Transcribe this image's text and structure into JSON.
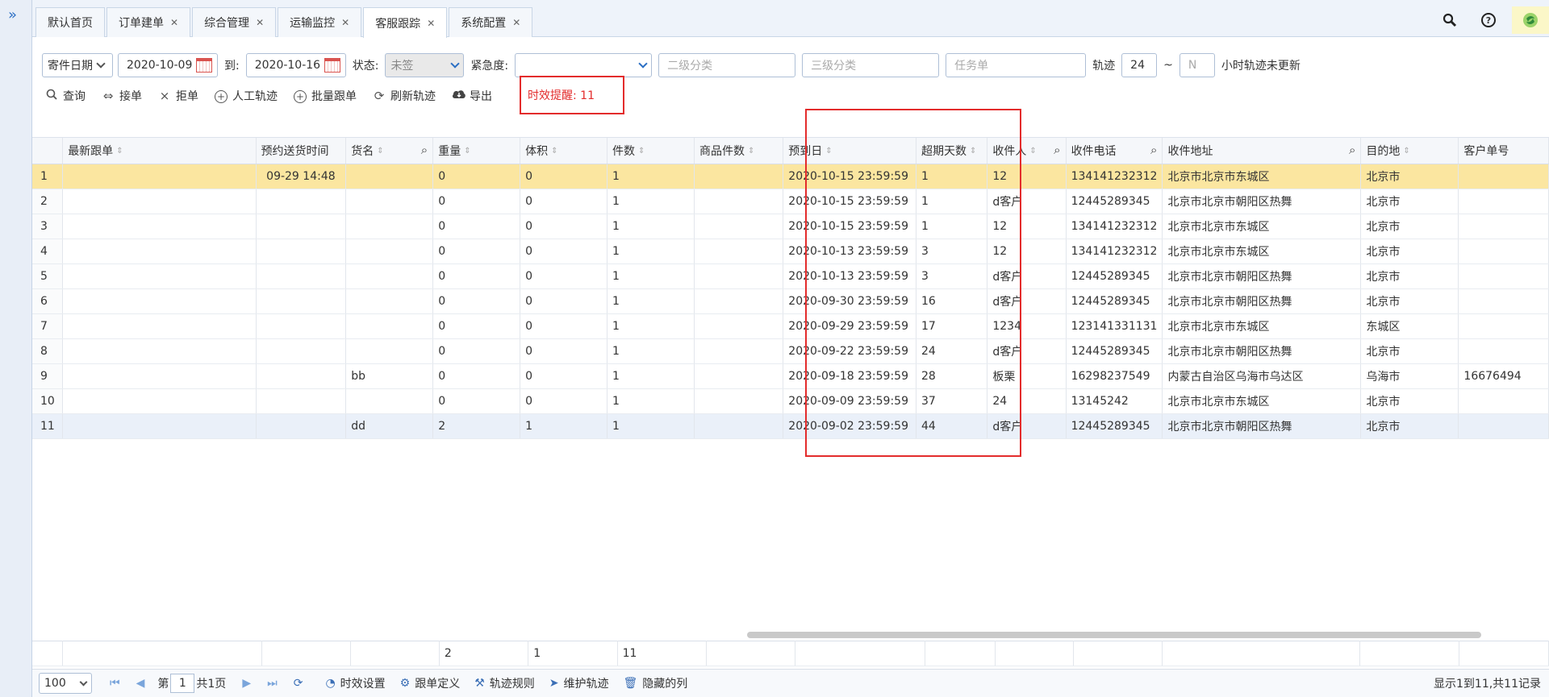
{
  "tabs": [
    {
      "label": "默认首页",
      "closable": false
    },
    {
      "label": "订单建单",
      "closable": true
    },
    {
      "label": "综合管理",
      "closable": true
    },
    {
      "label": "运输监控",
      "closable": true
    },
    {
      "label": "客服跟踪",
      "closable": true,
      "active": true
    },
    {
      "label": "系统配置",
      "closable": true
    }
  ],
  "top_icons": [
    "search-icon",
    "help-icon",
    "theme-icon"
  ],
  "filters": {
    "date_type": "寄件日期",
    "date_from": "2020-10-09",
    "to_label": "到:",
    "date_to": "2020-10-16",
    "status_label": "状态:",
    "status_value": "未签",
    "urgency_label": "紧急度:",
    "urgency_value": "",
    "level2_placeholder": "二级分类",
    "level3_placeholder": "三级分类",
    "task_placeholder": "任务单",
    "track_label": "轨迹",
    "track_from": "24",
    "tilde": "~",
    "track_to_placeholder": "N",
    "track_suffix": "小时轨迹未更新"
  },
  "actions": [
    {
      "label": "查询",
      "icon": "search-icon"
    },
    {
      "label": "接单",
      "icon": "link-icon"
    },
    {
      "label": "拒单",
      "icon": "close-icon"
    },
    {
      "label": "人工轨迹",
      "icon": "plus-circle-icon"
    },
    {
      "label": "批量跟单",
      "icon": "plus-circle-icon"
    },
    {
      "label": "刷新轨迹",
      "icon": "refresh-icon"
    },
    {
      "label": "导出",
      "icon": "cloud-download-icon"
    }
  ],
  "reminder": "时效提醒: 11",
  "columns": [
    "最新跟单",
    "预约送货时间",
    "货名",
    "重量",
    "体积",
    "件数",
    "商品件数",
    "预到日",
    "超期天数",
    "收件人",
    "收件电话",
    "收件地址",
    "目的地",
    "客户单号"
  ],
  "rows": [
    [
      "1",
      "",
      "09-29 14:48",
      "",
      "0",
      "0",
      "1",
      "",
      "2020-10-15 23:59:59",
      "1",
      "12",
      "134141232312",
      "北京市北京市东城区",
      "北京市",
      ""
    ],
    [
      "2",
      "",
      "",
      "",
      "0",
      "0",
      "1",
      "",
      "2020-10-15 23:59:59",
      "1",
      "d客户",
      "12445289345",
      "北京市北京市朝阳区热舞",
      "北京市",
      ""
    ],
    [
      "3",
      "",
      "",
      "",
      "0",
      "0",
      "1",
      "",
      "2020-10-15 23:59:59",
      "1",
      "12",
      "134141232312",
      "北京市北京市东城区",
      "北京市",
      ""
    ],
    [
      "4",
      "",
      "",
      "",
      "0",
      "0",
      "1",
      "",
      "2020-10-13 23:59:59",
      "3",
      "12",
      "134141232312",
      "北京市北京市东城区",
      "北京市",
      ""
    ],
    [
      "5",
      "",
      "",
      "",
      "0",
      "0",
      "1",
      "",
      "2020-10-13 23:59:59",
      "3",
      "d客户",
      "12445289345",
      "北京市北京市朝阳区热舞",
      "北京市",
      ""
    ],
    [
      "6",
      "",
      "",
      "",
      "0",
      "0",
      "1",
      "",
      "2020-09-30 23:59:59",
      "16",
      "d客户",
      "12445289345",
      "北京市北京市朝阳区热舞",
      "北京市",
      ""
    ],
    [
      "7",
      "",
      "",
      "",
      "0",
      "0",
      "1",
      "",
      "2020-09-29 23:59:59",
      "17",
      "1234",
      "123141331131",
      "北京市北京市东城区",
      "东城区",
      ""
    ],
    [
      "8",
      "",
      "",
      "",
      "0",
      "0",
      "1",
      "",
      "2020-09-22 23:59:59",
      "24",
      "d客户",
      "12445289345",
      "北京市北京市朝阳区热舞",
      "北京市",
      ""
    ],
    [
      "9",
      "",
      "",
      "bb",
      "0",
      "0",
      "1",
      "",
      "2020-09-18 23:59:59",
      "28",
      "板栗",
      "16298237549",
      "内蒙古自治区乌海市乌达区",
      "乌海市",
      "16676494"
    ],
    [
      "10",
      "",
      "",
      "",
      "0",
      "0",
      "1",
      "",
      "2020-09-09 23:59:59",
      "37",
      "24",
      "13145242",
      "北京市北京市东城区",
      "北京市",
      ""
    ],
    [
      "11",
      "",
      "",
      "dd",
      "2",
      "1",
      "1",
      "",
      "2020-09-02 23:59:59",
      "44",
      "d客户",
      "12445289345",
      "北京市北京市朝阳区热舞",
      "北京市",
      ""
    ]
  ],
  "summary": {
    "weight": "2",
    "volume": "1",
    "count": "11"
  },
  "pager": {
    "page_size": "100",
    "page_prefix": "第",
    "page_num": "1",
    "page_total": "共1页",
    "buttons": [
      {
        "label": "时效设置",
        "icon": "clock-icon"
      },
      {
        "label": "跟单定义",
        "icon": "gear-icon"
      },
      {
        "label": "轨迹规则",
        "icon": "tools-icon"
      },
      {
        "label": "维护轨迹",
        "icon": "navigate-icon"
      },
      {
        "label": "隐藏的列",
        "icon": "trash-icon"
      }
    ],
    "info": "显示1到11,共11记录"
  }
}
